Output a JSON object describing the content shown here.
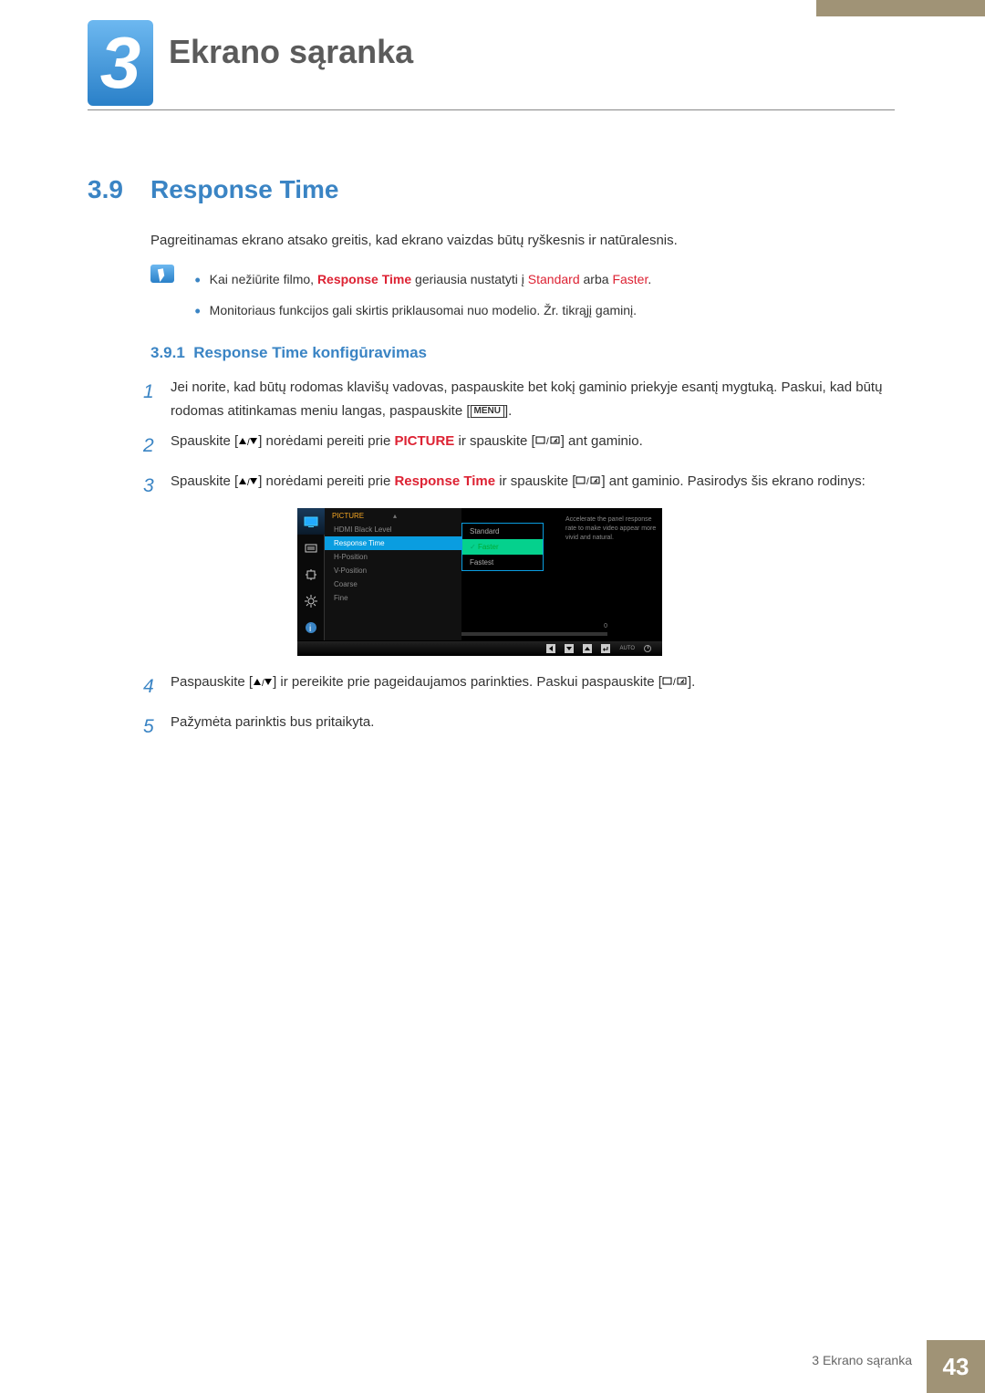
{
  "chapter": {
    "number": "3",
    "title": "Ekrano sąranka"
  },
  "section": {
    "number": "3.9",
    "title": "Response Time"
  },
  "intro": "Pagreitinamas ekrano atsako greitis, kad ekrano vaizdas būtų ryškesnis ir natūralesnis.",
  "notes": {
    "n1_pre": "Kai nežiūrite filmo, ",
    "n1_rt": "Response Time",
    "n1_mid": " geriausia nustatyti į ",
    "n1_std": "Standard",
    "n1_or": " arba ",
    "n1_fast": "Faster",
    "n1_end": ".",
    "n2": "Monitoriaus funkcijos gali skirtis priklausomai nuo modelio. Žr. tikrąjį gaminį."
  },
  "subsection": {
    "number": "3.9.1",
    "title": "Response Time konfigūravimas"
  },
  "steps": {
    "s1a": "Jei norite, kad būtų rodomas klavišų vadovas, paspauskite bet kokį gaminio priekyje esantį mygtuką. Paskui, kad būtų rodomas atitinkamas meniu langas, paspauskite [",
    "s1b": "].",
    "menu_lbl": "MENU",
    "s2a": "Spauskite [",
    "s2b": "] norėdami pereiti prie ",
    "picture": "PICTURE",
    "s2c": " ir spauskite [",
    "s2d": "] ant gaminio.",
    "s3a": "Spauskite [",
    "s3b": "] norėdami pereiti prie ",
    "rt": "Response Time",
    "s3c": " ir spauskite [",
    "s3d": "] ant gaminio. Pasirodys šis ekrano rodinys:",
    "s4a": "Paspauskite [",
    "s4b": "] ir pereikite prie pageidaujamos parinkties. Paskui paspauskite [",
    "s4c": "].",
    "s5": "Pažymėta parinktis bus pritaikyta."
  },
  "osd": {
    "title": "PICTURE",
    "items": [
      "HDMI Black Level",
      "Response Time",
      "H-Position",
      "V-Position",
      "Coarse",
      "Fine"
    ],
    "options": [
      "Standard",
      "Faster",
      "Fastest"
    ],
    "info": "Accelerate the panel response rate to make video appear more vivid and natural.",
    "slider_val": "0",
    "auto": "AUTO"
  },
  "footer": {
    "chapter": "3 Ekrano sąranka",
    "page": "43"
  }
}
